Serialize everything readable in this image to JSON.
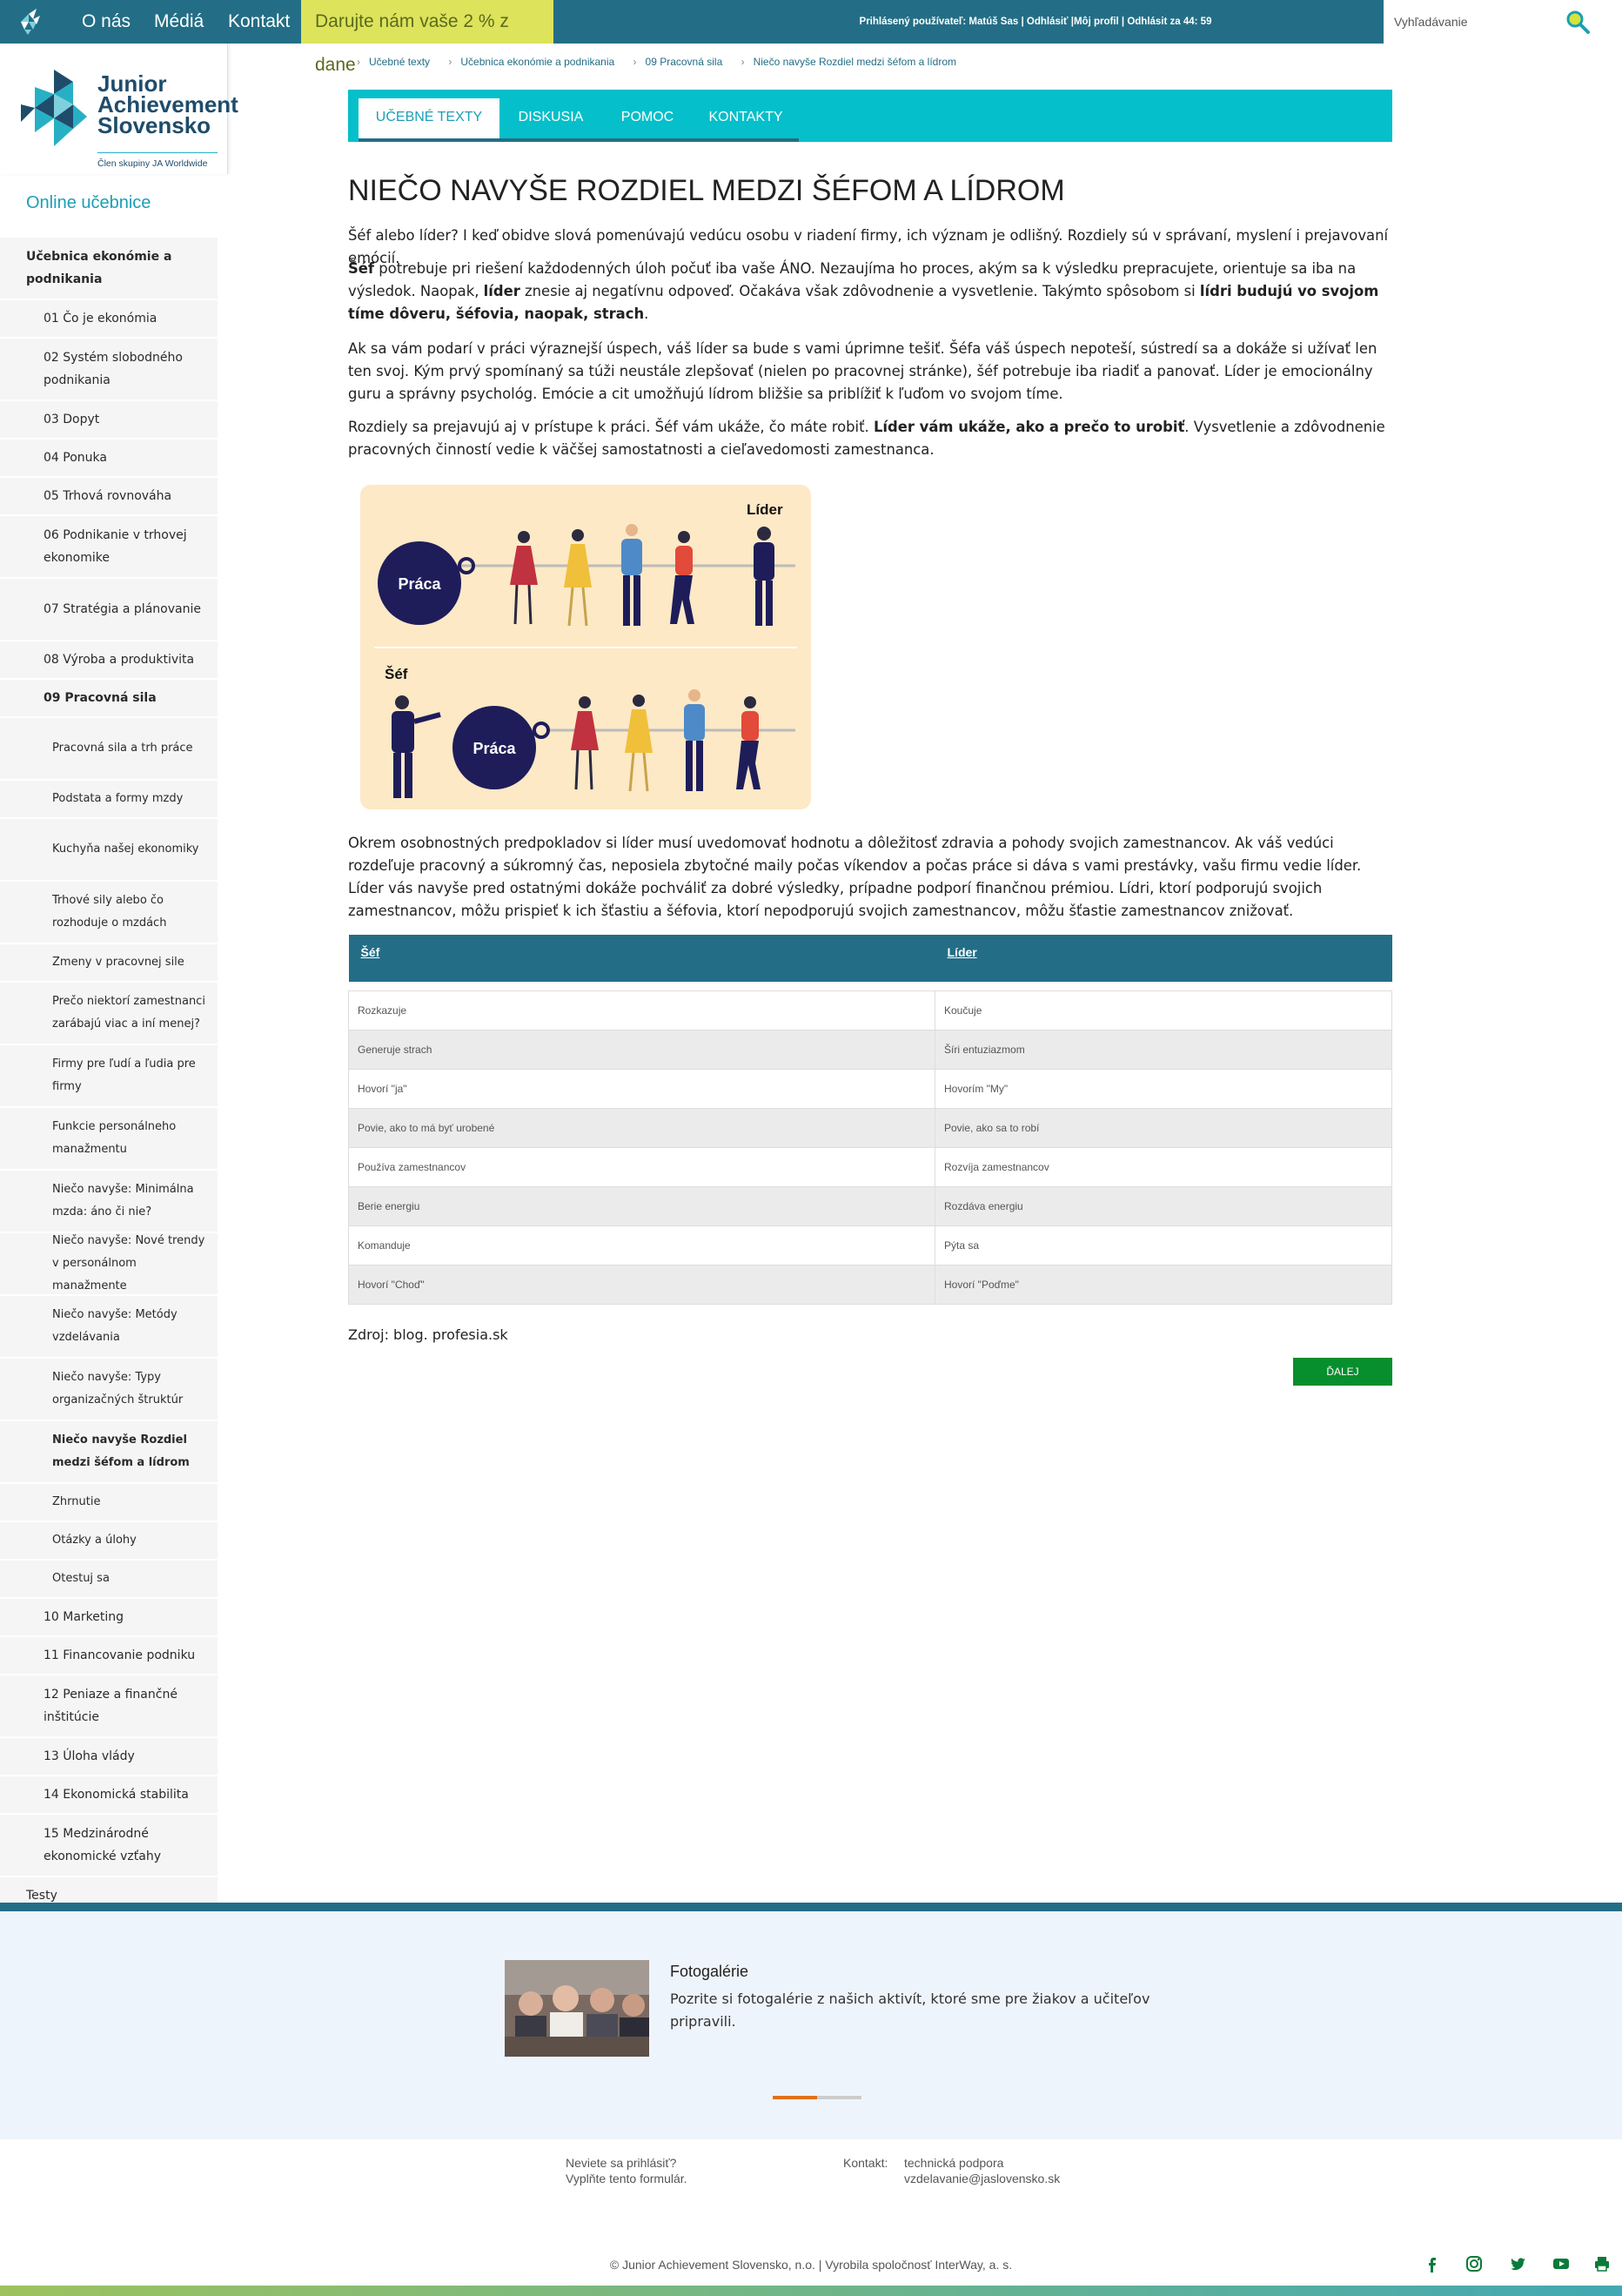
{
  "topbar": {
    "nav": [
      "O nás",
      "Médiá",
      "Kontakt"
    ],
    "donate": "Darujte nám vaše 2 % z dane",
    "user_info": "Prihlásený používateľ: Matúš Sas | Odhlásiť |Môj profil | Odhlásit za 44: 59",
    "search_placeholder": "Vyhľadávanie"
  },
  "logo": {
    "line1": "Junior",
    "line2": "Achievement",
    "line3": "Slovensko",
    "sub": "Člen skupiny JA Worldwide"
  },
  "sidebar": {
    "title": "Online učebnice",
    "items": [
      {
        "label": "Učebnica ekonómie a podnikania",
        "level": 0,
        "bold": true
      },
      {
        "label": "01 Čo je ekonómia",
        "level": 1
      },
      {
        "label": "02 Systém slobodného podnikania",
        "level": 1
      },
      {
        "label": "03 Dopyt",
        "level": 1
      },
      {
        "label": "04 Ponuka",
        "level": 1
      },
      {
        "label": "05 Trhová rovnováha",
        "level": 1
      },
      {
        "label": "06 Podnikanie v trhovej ekonomike",
        "level": 1
      },
      {
        "label": "07 Stratégia a plánovanie",
        "level": 1
      },
      {
        "label": "08 Výroba a produktivita",
        "level": 1
      },
      {
        "label": "09 Pracovná sila",
        "level": 1,
        "bold": true
      },
      {
        "label": "Pracovná sila a trh práce",
        "level": 2
      },
      {
        "label": "Podstata a formy mzdy",
        "level": 2
      },
      {
        "label": "Kuchyňa našej ekonomiky",
        "level": 2
      },
      {
        "label": "Trhové sily alebo čo rozhoduje o mzdách",
        "level": 2
      },
      {
        "label": "Zmeny v pracovnej sile",
        "level": 2
      },
      {
        "label": "Prečo niektorí zamestnanci zarábajú viac a iní menej?",
        "level": 2
      },
      {
        "label": "Firmy pre ľudí a ľudia pre firmy",
        "level": 2
      },
      {
        "label": "Funkcie personálneho manažmentu",
        "level": 2
      },
      {
        "label": "Niečo navyše: Minimálna mzda: áno či nie?",
        "level": 2
      },
      {
        "label": "Niečo navyše: Nové trendy v personálnom manažmente",
        "level": 2
      },
      {
        "label": "Niečo navyše: Metódy vzdelávania",
        "level": 2
      },
      {
        "label": "Niečo navyše: Typy organizačných štruktúr",
        "level": 2
      },
      {
        "label": "Niečo navyše Rozdiel medzi šéfom a lídrom",
        "level": 2,
        "bold": true
      },
      {
        "label": "Zhrnutie",
        "level": 2
      },
      {
        "label": "Otázky a úlohy",
        "level": 2
      },
      {
        "label": "Otestuj sa",
        "level": 2
      },
      {
        "label": "10 Marketing",
        "level": 1
      },
      {
        "label": "11 Financovanie podniku",
        "level": 1
      },
      {
        "label": "12 Peniaze a finančné inštitúcie",
        "level": 1
      },
      {
        "label": "13 Úloha vlády",
        "level": 1
      },
      {
        "label": "14 Ekonomická stabilita",
        "level": 1
      },
      {
        "label": "15 Medzinárodné ekonomické vzťahy",
        "level": 1
      },
      {
        "label": "Testy",
        "level": 0
      }
    ]
  },
  "breadcrumb": [
    "Učebné texty",
    "Učebnica ekonómie a podnikania",
    "09 Pracovná sila",
    "Niečo navyše Rozdiel medzi šéfom a lídrom"
  ],
  "tabs": [
    "UČEBNÉ TEXTY",
    "DISKUSIA",
    "POMOC",
    "KONTAKTY"
  ],
  "article": {
    "title": "NIEČO NAVYŠE ROZDIEL MEDZI ŠÉFOM A LÍDROM",
    "p1": "Šéf alebo líder? I keď obidve slová pomenúvajú vedúcu osobu v riadení firmy, ich význam je odlišný. Rozdiely sú v správaní, myslení i prejavovaní emócií.",
    "p2_b1": "Šéf",
    "p2_t1": " potrebuje pri riešení každodenných úloh počuť iba vaše ÁNO. Nezaujíma ho proces, akým sa k výsledku prepracujete, orientuje sa iba na výsledok. Naopak, ",
    "p2_b2": "líder",
    "p2_t2": " znesie aj negatívnu odpoveď. Očakáva však zdôvodnenie a vysvetlenie. Takýmto spôsobom si ",
    "p2_b3": "lídri budujú vo svojom tíme dôveru, šéfovia, naopak, strach",
    "p2_t3": ".",
    "p3": "Ak sa vám podarí v práci výraznejší úspech, váš líder sa bude s vami úprimne tešiť. Šéfa váš úspech nepoteší, sústredí sa a dokáže si užívať len ten svoj. Kým prvý spomínaný sa túži neustále zlepšovať (nielen po pracovnej stránke), šéf potrebuje iba riadiť a panovať. Líder je emocionálny guru a správny psychológ. Emócie a cit umožňujú lídrom bližšie sa priblížiť k ľuďom vo svojom tíme.",
    "p4_t1": "Rozdiely sa prejavujú aj v prístupe k práci. Šéf vám ukáže, čo máte robiť. ",
    "p4_b1": "Líder vám ukáže, ako a prečo to urobiť",
    "p4_t2": ". Vysvetlenie a zdôvodnenie pracovných činností vedie k väčšej samostatnosti a cieľavedomosti zamestnanca.",
    "p5": "Okrem osobnostných predpokladov si líder musí uvedomovať hodnotu a dôležitosť zdravia a pohody svojich zamestnancov. Ak váš vedúci rozdeľuje pracovný a súkromný čas, neposiela zbytočné maily počas víkendov a počas práce si dáva s vami prestávky, vašu firmu vedie líder. Líder vás navyše pred ostatnými dokáže pochváliť za dobré výsledky, prípadne podporí finančnou prémiou. Lídri, ktorí podporujú svojich zamestnancov, môžu prispieť k ich šťastiu a šéfovia, ktorí nepodporujú svojich zamestnancov, môžu šťastie zamestnancov znižovať.",
    "source": "Zdroj: blog. profesia.sk",
    "next": "ĎALEJ"
  },
  "illustration": {
    "leader_label": "Líder",
    "boss_label": "Šéf",
    "work_label_top": "Práca",
    "work_label_bottom": "Práca"
  },
  "table": {
    "headers": [
      "Šéf",
      "Líder"
    ],
    "rows": [
      [
        "Rozkazuje",
        "Koučuje"
      ],
      [
        "Generuje strach",
        "Šíri entuziazmom"
      ],
      [
        "Hovorí \"ja\"",
        "Hovorím \"My\""
      ],
      [
        "Povie, ako to má byť urobené",
        "Povie, ako sa to robí"
      ],
      [
        "Používa zamestnancov",
        "Rozvíja zamestnancov"
      ],
      [
        "Berie energiu",
        "Rozdáva energiu"
      ],
      [
        "Komanduje",
        "Pýta sa"
      ],
      [
        "Hovorí \"Choď\"",
        "Hovorí \"Poďme\""
      ]
    ]
  },
  "footer": {
    "gallery_title": "Fotogalérie",
    "gallery_desc": "Pozrite si fotogalérie z našich aktivít, ktoré sme pre žiakov a učiteľov pripravili.",
    "login_q": "Neviete sa prihlásiť?",
    "login_a": "Vyplňte tento formulár.",
    "contact_label": "Kontakt:",
    "contact_name": "technická podpora",
    "contact_email": "vzdelavanie@jaslovensko.sk",
    "copyright": "© Junior Achievement Slovensko, n.o. | Vyrobila spoločnosť InterWay, a. s.",
    "social_icons": [
      "facebook-icon",
      "instagram-icon",
      "twitter-icon",
      "youtube-icon",
      "print-icon"
    ],
    "slider_progress": 0.5
  },
  "colors": {
    "topbar": "#236e86",
    "tabs": "#05bfca",
    "donate": "#dde35a",
    "next_button": "#078e2d",
    "illustration_bg": "#fde9c6"
  }
}
